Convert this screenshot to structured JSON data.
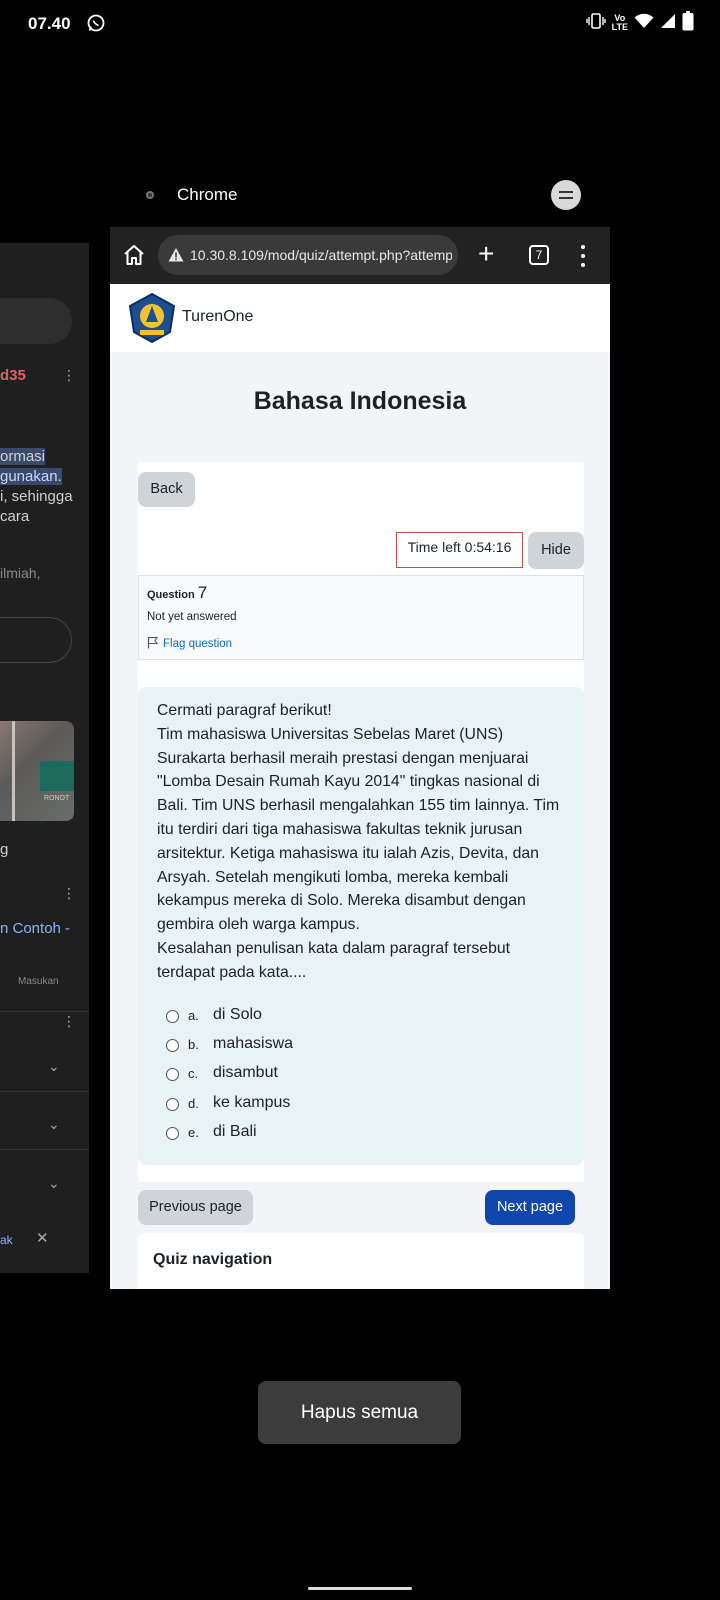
{
  "status_bar": {
    "time": "07.40",
    "volte_label": "Vo",
    "lte_label": "LTE"
  },
  "background_card": {
    "text_lines": [
      "ormasi",
      "gunakan.",
      "i, sehingga",
      "cara",
      "ilmiah,",
      "g",
      "n Contoh -",
      "Masukan",
      "ak"
    ],
    "badge": "d35",
    "image_sign": "RONOT"
  },
  "app_header": {
    "name": "Chrome"
  },
  "browser": {
    "url": "10.30.8.109/mod/quiz/attempt.php?attempt",
    "tab_count": "7",
    "new_tab_symbol": "+"
  },
  "site": {
    "name": "TurenOne"
  },
  "page": {
    "title": "Bahasa Indonesia",
    "back_label": "Back",
    "timer_label": "Time left 0:54:16",
    "hide_label": "Hide"
  },
  "question": {
    "label": "Question",
    "number": "7",
    "status": "Not yet answered",
    "flag_label": "Flag question",
    "text": [
      "Cermati paragraf berikut!",
      "Tim mahasiswa Universitas Sebelas Maret (UNS)",
      "Surakarta berhasil meraih prestasi dengan menjuarai",
      "\"Lomba Desain Rumah Kayu 2014\" tingkas nasional di",
      "Bali. Tim UNS berhasil mengalahkan 155 tim lainnya. Tim",
      "itu terdiri dari tiga mahasiswa fakultas teknik jurusan",
      "arsitektur. Ketiga mahasiswa itu ialah Azis, Devita, dan",
      "Arsyah. Setelah mengikuti lomba, mereka kembali",
      "kekampus mereka di Solo. Mereka disambut dengan",
      "gembira oleh warga kampus.",
      "Kesalahan penulisan kata dalam paragraf tersebut",
      "terdapat pada kata...."
    ],
    "answers": [
      {
        "letter": "a.",
        "text": "di Solo"
      },
      {
        "letter": "b.",
        "text": "mahasiswa"
      },
      {
        "letter": "c.",
        "text": "disambut"
      },
      {
        "letter": "d.",
        "text": "ke kampus"
      },
      {
        "letter": "e.",
        "text": "di Bali"
      }
    ]
  },
  "navigation": {
    "previous_label": "Previous page",
    "next_label": "Next page",
    "quiz_nav_title": "Quiz navigation"
  },
  "recents": {
    "clear_all_label": "Hapus semua"
  }
}
